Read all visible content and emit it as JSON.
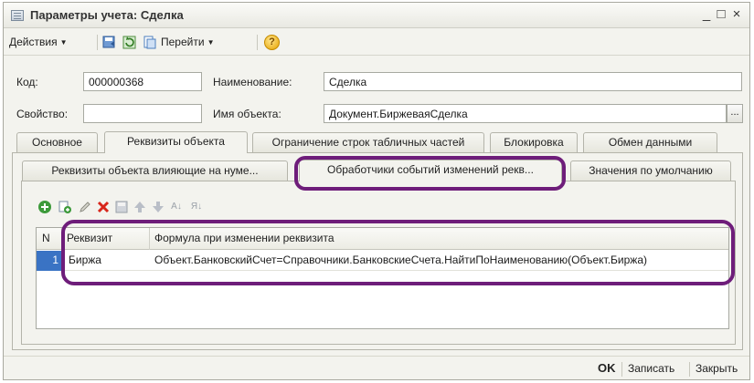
{
  "window": {
    "title": "Параметры учета: Сделка",
    "minimize_glyph": "_",
    "maximize_glyph": "□",
    "close_glyph": "×"
  },
  "toolbar": {
    "actions_label": "Действия",
    "goto_label": "Перейти",
    "help_glyph": "?",
    "icons": [
      "save-and-close-icon",
      "refresh-icon",
      "copy-doc-icon",
      "help-icon"
    ]
  },
  "form": {
    "code_label": "Код:",
    "code_value": "000000368",
    "name_label": "Наименование:",
    "name_value": "Сделка",
    "property_label": "Свойство:",
    "property_value": "",
    "object_name_label": "Имя объекта:",
    "object_name_value": "Документ.БиржеваяСделка",
    "dots_glyph": "..."
  },
  "tabs": [
    {
      "label": "Основное"
    },
    {
      "label": "Реквизиты объекта"
    },
    {
      "label": "Ограничение строк табличных частей"
    },
    {
      "label": "Блокировка"
    },
    {
      "label": "Обмен данными"
    }
  ],
  "subtabs": [
    {
      "label": "Реквизиты объекта влияющие на нуме..."
    },
    {
      "label": "Обработчики событий изменений рекв..."
    },
    {
      "label": "Значения по умолчанию"
    }
  ],
  "grid_toolbar": {
    "icons": [
      "add-icon",
      "copy-row-icon",
      "edit-icon",
      "delete-icon",
      "end-edit-icon",
      "move-up-icon",
      "move-down-icon",
      "sort-asc-icon",
      "sort-desc-icon"
    ]
  },
  "table": {
    "columns": [
      "N",
      "Реквизит",
      "Формула при изменении реквизита"
    ],
    "rows": [
      {
        "n": "1",
        "attribute": "Биржа",
        "formula": "Объект.БанковскийСчет=Справочники.БанковскиеСчета.НайтиПоНаименованию(Объект.Биржа)"
      }
    ]
  },
  "footer": {
    "ok_label": "OK",
    "save_label": "Записать",
    "close_label": "Закрыть"
  },
  "colors": {
    "highlight": "#6e1d7a",
    "selected_row_number": "#3a73c4"
  }
}
